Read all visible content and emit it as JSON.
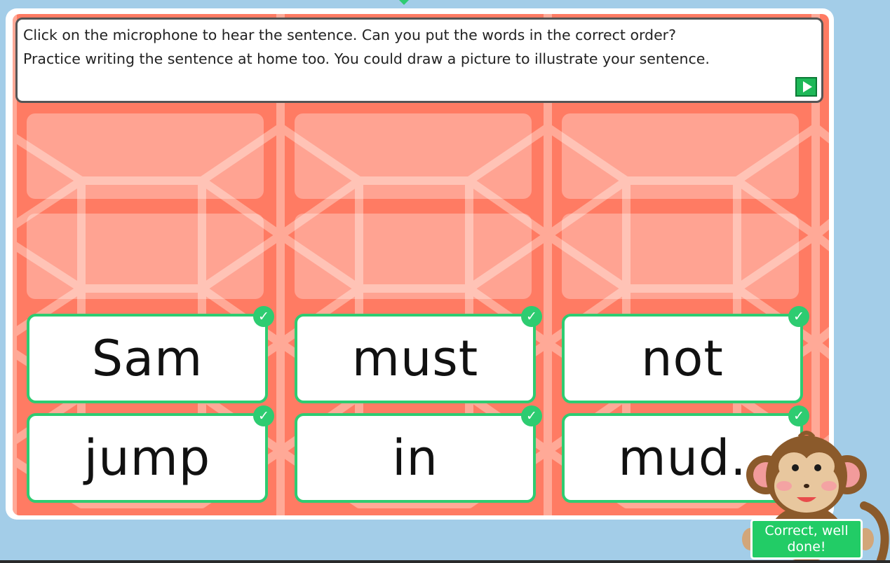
{
  "instructions": {
    "line1": "Click on the microphone to hear the sentence. Can you put the words in the correct order?",
    "line2": "Practice writing the sentence at home too. You could draw a picture to illustrate your sentence."
  },
  "words": [
    "Sam",
    "must",
    "not",
    "jump",
    "in",
    "mud."
  ],
  "feedback": {
    "line1": "Correct, well",
    "line2": "done!"
  },
  "icons": {
    "play": "play-icon",
    "check": "checkmark-icon",
    "mascot": "monkey-mascot"
  },
  "colors": {
    "background": "#a3cde8",
    "board": "#ff7b63",
    "correct": "#2ecc71",
    "play_button": "#1eb858"
  }
}
